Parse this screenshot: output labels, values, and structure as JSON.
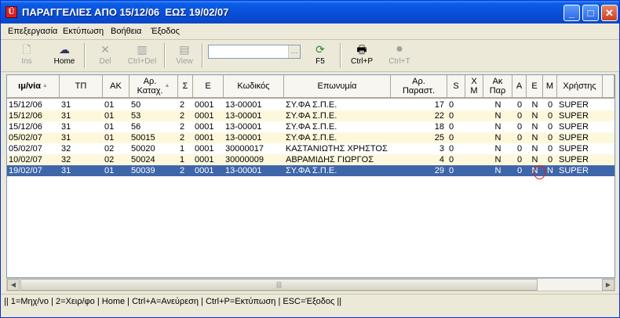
{
  "window": {
    "title": "ΠΑΡΑΓΓΕΛΙΕΣ ΑΠΟ 15/12/06  ΕΩΣ 19/02/07",
    "app_icon": "app-logo-icon",
    "controls": {
      "minimize": "_",
      "maximize": "□",
      "close": "✕"
    }
  },
  "menu": [
    "Επεξεργασία",
    "Εκτύπωση",
    "Βοήθεια",
    "Έξοδος"
  ],
  "toolbar": {
    "ins": "Ins",
    "home": "Home",
    "del": "Del",
    "ctrl_del": "Ctrl+Del",
    "view": "View",
    "search_value": "",
    "f5": "F5",
    "ctrl_p": "Ctrl+P",
    "ctrl_t": "Ctrl+T"
  },
  "table": {
    "headers": [
      "Ημ/νία",
      "ΤΠ",
      "ΑΚ",
      "Αρ.\nΚαταχ.",
      "Σ",
      "Ε",
      "Κωδικός",
      "Επωνυμία",
      "Αρ.\nΠαραστ.",
      "S",
      "Χ\nΜ",
      "Ακ\nΠαρ",
      "Α",
      "Ε",
      "Μ",
      "Χρήστης"
    ],
    "header_first_visible": "ιμ/νία",
    "rows": [
      [
        "15/12/06",
        "31",
        "01",
        "50",
        "2",
        "0001",
        "13-00001",
        "ΣΥ.ΦΑ Σ.Π.Ε.",
        "17",
        "0",
        "",
        "N",
        "0",
        "N",
        "0",
        "SUPER"
      ],
      [
        "15/12/06",
        "31",
        "01",
        "53",
        "2",
        "0001",
        "13-00001",
        "ΣΥ.ΦΑ Σ.Π.Ε.",
        "22",
        "0",
        "",
        "N",
        "0",
        "N",
        "0",
        "SUPER"
      ],
      [
        "15/12/06",
        "31",
        "01",
        "56",
        "2",
        "0001",
        "13-00001",
        "ΣΥ.ΦΑ Σ.Π.Ε.",
        "18",
        "0",
        "",
        "N",
        "0",
        "N",
        "0",
        "SUPER"
      ],
      [
        "05/02/07",
        "31",
        "01",
        "50015",
        "2",
        "0001",
        "13-00001",
        "ΣΥ.ΦΑ Σ.Π.Ε.",
        "25",
        "0",
        "",
        "N",
        "0",
        "N",
        "0",
        "SUPER"
      ],
      [
        "05/02/07",
        "32",
        "02",
        "50020",
        "1",
        "0001",
        "30000017",
        "ΚΑΣΤΑΝΙΩΤΗΣ ΧΡΗΣΤΟΣ",
        "3",
        "0",
        "",
        "N",
        "0",
        "N",
        "0",
        "SUPER"
      ],
      [
        "10/02/07",
        "32",
        "02",
        "50024",
        "1",
        "0001",
        "30000009",
        "ΑΒΡΑΜΙΔΗΣ ΓΙΩΡΓΟΣ",
        "4",
        "0",
        "",
        "N",
        "0",
        "N",
        "0",
        "SUPER"
      ],
      [
        "19/02/07",
        "31",
        "01",
        "50039",
        "2",
        "0001",
        "13-00001",
        "ΣΥ.ΦΑ Σ.Π.Ε.",
        "29",
        "0",
        "",
        "N",
        "0",
        "N",
        "N",
        "SUPER"
      ]
    ],
    "selected_row": 6
  },
  "status": "|| 1=Μηχ/νο | 2=Χειρ/φο | Home | Ctrl+A=Ανεύρεση | Ctrl+P=Εκτύπωση | ESC=Έξοδος ||",
  "colors": {
    "selection": "#3f66a9",
    "alt_row": "#fdf8dc",
    "titlebar": "#0a4fd8",
    "highlight_circle": "#e02020"
  }
}
